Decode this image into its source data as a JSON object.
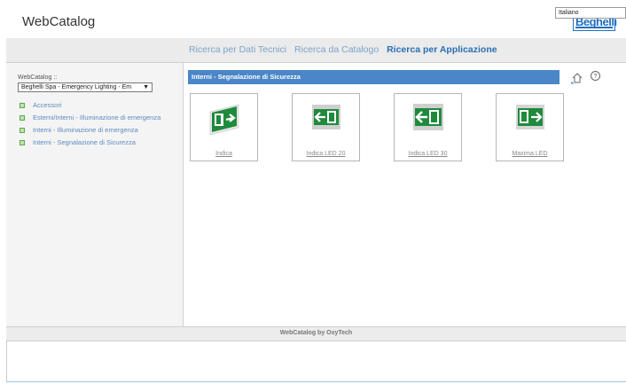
{
  "app": {
    "title": "WebCatalog",
    "logo": "Beghelli",
    "brand_color": "#1f6fc1"
  },
  "nav": {
    "links": [
      {
        "label": "Ricerca per Dati Tecnici",
        "active": false
      },
      {
        "label": "Ricerca da Catalogo",
        "active": false
      },
      {
        "label": "Ricerca per Applicazione",
        "active": true
      }
    ],
    "language": "Italiano"
  },
  "sidebar": {
    "breadcrumb": "WebCatalog ::",
    "catalog_select": "Beghelli Spa - Emergency Lighting - Em",
    "items": [
      {
        "label": "Accessori"
      },
      {
        "label": "Esterni/Interni - Illuminazione di emergenza"
      },
      {
        "label": "Interni - Illuminazione di emergenza"
      },
      {
        "label": "Interni - Segnalazione di Sicurezza"
      }
    ]
  },
  "content": {
    "section_title": "Interni - Segnalazione di Sicurezza",
    "bar_color": "#4a86c8",
    "products": [
      {
        "label": "Indica",
        "icon": "exit-sign-angled-icon"
      },
      {
        "label": "Indica LED 20",
        "icon": "exit-sign-left-icon"
      },
      {
        "label": "Indica LED 30",
        "icon": "exit-sign-left-icon"
      },
      {
        "label": "Maxima LED",
        "icon": "exit-sign-right-icon"
      }
    ]
  },
  "footer": {
    "text": "WebCatalog by OxyTech"
  }
}
